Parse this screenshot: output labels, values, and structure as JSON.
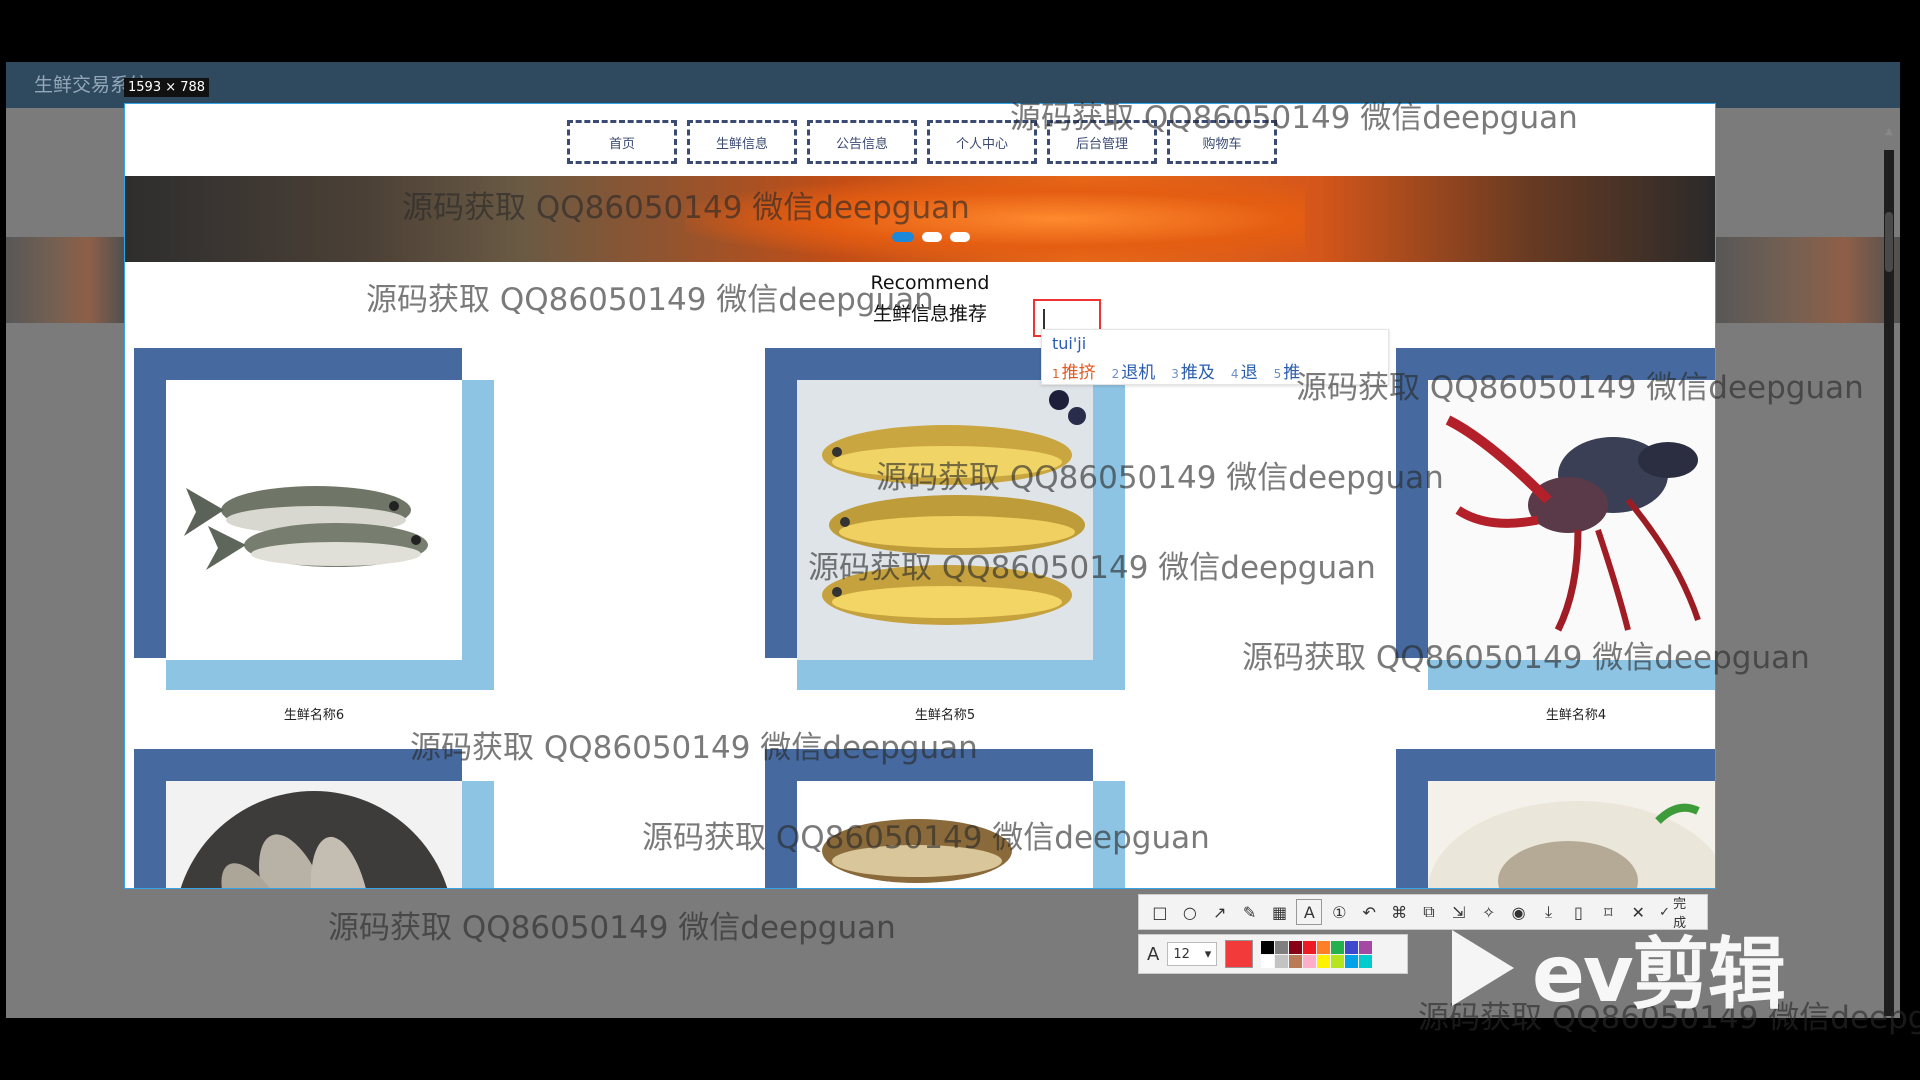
{
  "outer_title": "生鲜交易系统",
  "selection_size": "1593 × 788",
  "nav": {
    "items": [
      "首页",
      "生鲜信息",
      "公告信息",
      "个人中心",
      "后台管理",
      "购物车"
    ]
  },
  "section": {
    "title_en": "Recommend",
    "title_cn": "生鲜信息推荐"
  },
  "ime": {
    "input": "tui'ji",
    "candidates": [
      {
        "num": "1",
        "text": "推挤"
      },
      {
        "num": "2",
        "text": "退机"
      },
      {
        "num": "3",
        "text": "推及"
      },
      {
        "num": "4",
        "text": "退"
      },
      {
        "num": "5",
        "text": "推"
      }
    ]
  },
  "products": [
    {
      "name": "生鲜名称6",
      "image": "silver-carp-photo"
    },
    {
      "name": "生鲜名称5",
      "image": "yellow-croaker-photo"
    },
    {
      "name": "生鲜名称4",
      "image": "crayfish-photo"
    },
    {
      "name": "",
      "image": "shrimp-plate-photo"
    },
    {
      "name": "",
      "image": "carp-photo"
    },
    {
      "name": "",
      "image": "shrimp-bowl-photo"
    }
  ],
  "watermark": "源码获取 QQ86050149 微信deepguan",
  "toolbar": {
    "done_label": "完成",
    "font_size": "12",
    "current_color": "#f23a3a",
    "palette": [
      "#000000",
      "#7f7f7f",
      "#880015",
      "#ed1c24",
      "#ff7f27",
      "#22b14c",
      "#3f48cc",
      "#a349a4",
      "#ffffff",
      "#c3c3c3",
      "#b97a57",
      "#ffaec9",
      "#fff200",
      "#b5e61d",
      "#00a2e8",
      "#00cccc"
    ]
  },
  "logo": {
    "text": "ev剪辑"
  }
}
